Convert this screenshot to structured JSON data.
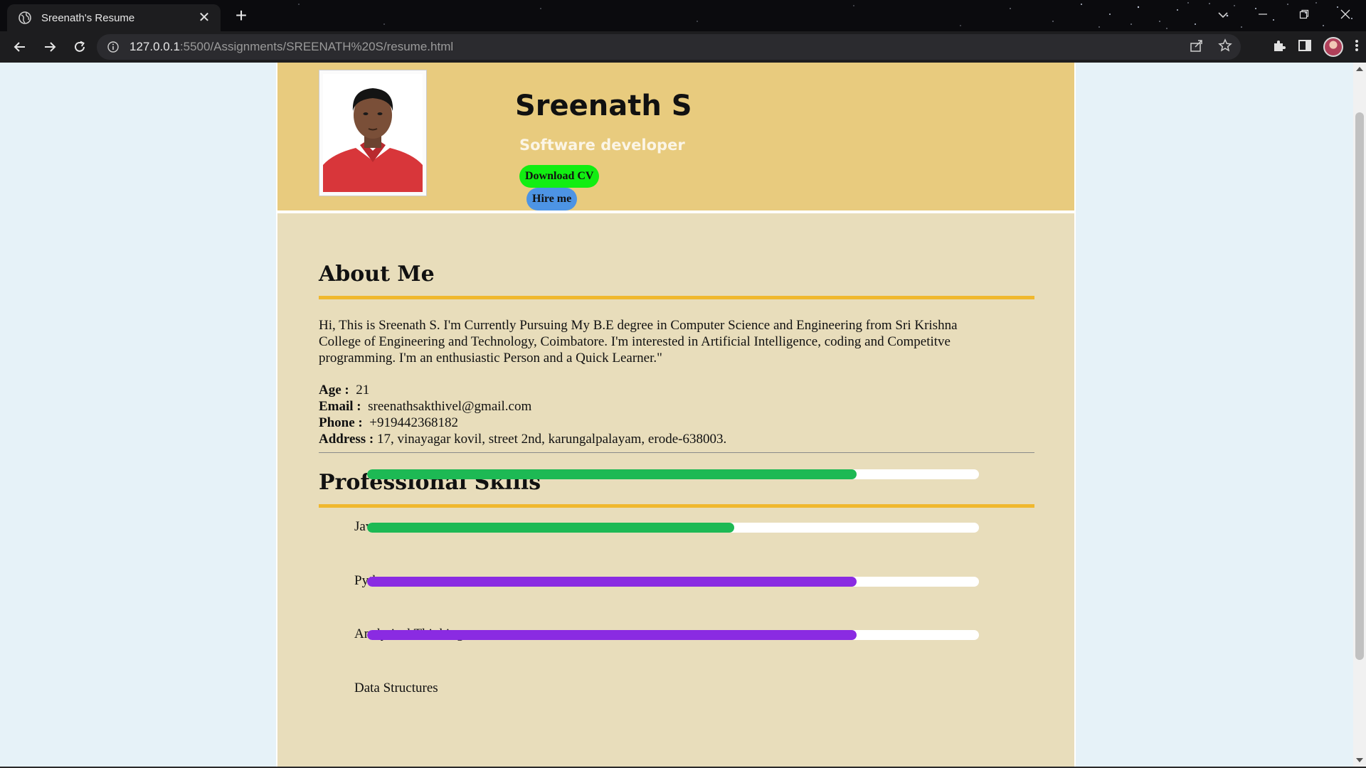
{
  "browser": {
    "tab_title": "Sreenath's Resume",
    "tab_close": "✕",
    "new_tab": "+",
    "url_host": "127.0.0.1",
    "url_rest": ":5500/Assignments/SREENATH%20S/resume.html"
  },
  "header": {
    "name": "Sreenath S",
    "role": "Software developer",
    "download_label": "Download CV",
    "hire_label": "Hire me"
  },
  "about": {
    "title": "About Me",
    "text": "Hi, This is Sreenath S. I'm Currently Pursuing My B.E degree in Computer Science and Engineering from Sri Krishna College of Engineering and Technology, Coimbatore. I'm interested in Artificial Intelligence, coding and Competitve programming. I'm an enthusiastic Person and a Quick Learner.\"",
    "age_label": "Age :",
    "age": "21",
    "email_label": "Email :",
    "email": "sreenathsakthivel@gmail.com",
    "phone_label": "Phone :",
    "phone": "+919442368182",
    "address_label": "Address :",
    "address": "17, vinayagar kovil, street 2nd, karungalpalayam, erode-638003."
  },
  "skills": {
    "title": "Professional Skills",
    "items": [
      {
        "label": "Java",
        "level": 0.8,
        "color": "#1db954"
      },
      {
        "label": "Python",
        "level": 0.6,
        "color": "#1db954"
      },
      {
        "label": "Analytical Thinking",
        "level": 0.8,
        "color": "#8a2be2"
      },
      {
        "label": "Data Structures",
        "level": 0.8,
        "color": "#8a2be2"
      }
    ]
  },
  "colors": {
    "header_bg": "#e8cb7e",
    "content_bg": "#e8ddbb",
    "accent_rule": "#f0b82e",
    "download_btn": "#12ee12",
    "hire_btn": "#4d94e4"
  }
}
